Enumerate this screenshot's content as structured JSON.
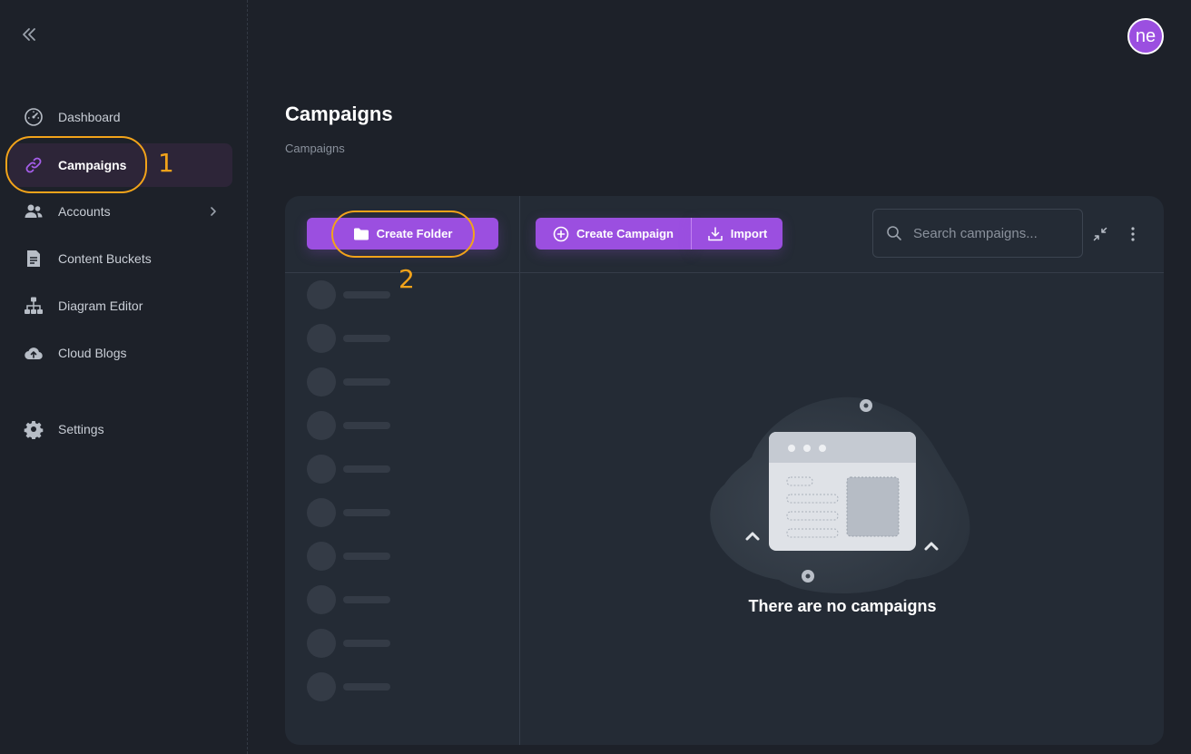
{
  "sidebar": {
    "items": [
      {
        "label": "Dashboard",
        "icon": "dashboard-gauge-icon"
      },
      {
        "label": "Campaigns",
        "icon": "link-icon"
      },
      {
        "label": "Accounts",
        "icon": "users-icon"
      },
      {
        "label": "Content Buckets",
        "icon": "document-icon"
      },
      {
        "label": "Diagram Editor",
        "icon": "sitemap-icon"
      },
      {
        "label": "Cloud Blogs",
        "icon": "cloud-upload-icon"
      },
      {
        "label": "Settings",
        "icon": "gear-icon"
      }
    ],
    "active": "Campaigns"
  },
  "user": {
    "avatar_text": "ne"
  },
  "page": {
    "title": "Campaigns",
    "breadcrumb": "Campaigns"
  },
  "toolbar": {
    "create_folder_label": "Create Folder",
    "create_campaign_label": "Create Campaign",
    "import_label": "Import",
    "search_placeholder": "Search campaigns..."
  },
  "empty_state": {
    "message": "There are no campaigns"
  },
  "annotations": [
    {
      "number": "1"
    },
    {
      "number": "2"
    }
  ],
  "colors": {
    "accent": "#9b4fe0",
    "annotation": "#f2a31a",
    "background": "#1d2129",
    "panel": "#242b35"
  }
}
